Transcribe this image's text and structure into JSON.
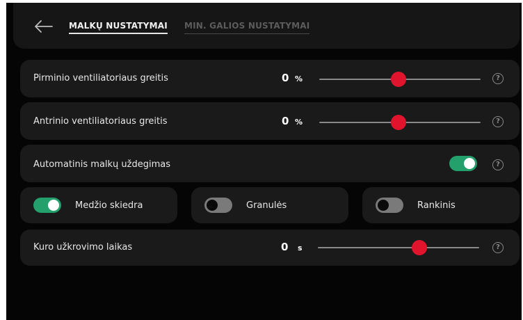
{
  "header": {
    "back_icon": "arrow-left-icon",
    "tabs": [
      {
        "label": "MALKŲ NUSTATYMAI",
        "active": true
      },
      {
        "label": "MIN. GALIOS NUSTATYMAI",
        "active": false
      }
    ]
  },
  "settings": {
    "primary_fan": {
      "label": "Pirminio ventiliatoriaus greitis",
      "value": "0",
      "unit": "%",
      "slider_fraction": 0.49
    },
    "secondary_fan": {
      "label": "Antrinio ventiliatoriaus greitis",
      "value": "0",
      "unit": "%",
      "slider_fraction": 0.49
    },
    "auto_ignition": {
      "label": "Automatinis malkų uždegimas",
      "enabled": true
    },
    "fuel_types": [
      {
        "label": "Medžio skiedra",
        "enabled": true
      },
      {
        "label": "Granulės",
        "enabled": false
      },
      {
        "label": "Rankinis",
        "enabled": false
      }
    ],
    "fuel_load_time": {
      "label": "Kuro užkrovimo laikas",
      "value": "0",
      "unit": "s",
      "slider_fraction": 0.63
    }
  },
  "colors": {
    "accent": "#e0142c",
    "toggle_on": "#23a06b",
    "toggle_off": "#7a7a7a"
  },
  "icons": {
    "help": "question-circle-icon"
  }
}
